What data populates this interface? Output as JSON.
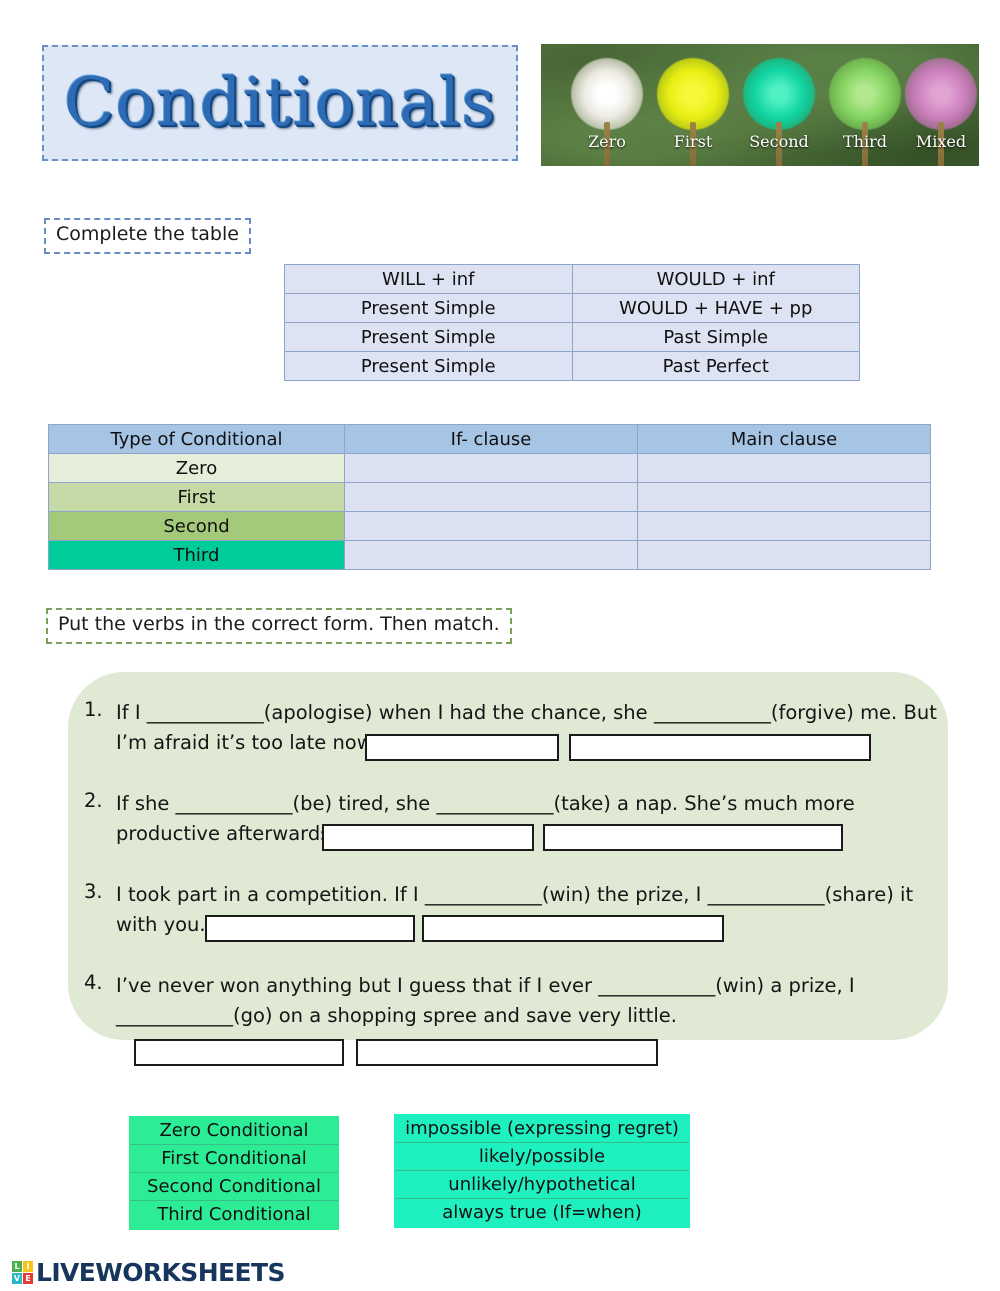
{
  "title": {
    "heading": "Conditionals"
  },
  "banner": {
    "alt": "five colored dandelion puffballs",
    "labels": [
      "Zero",
      "First",
      "Second",
      "Third",
      "Mixed"
    ],
    "colors": [
      "#ece9e0",
      "#e8ee12",
      "#11d5a2",
      "#86d562",
      "#cb7fbd"
    ]
  },
  "instructions": {
    "first": "Complete the table",
    "second": "Put the verbs in the correct form. Then match."
  },
  "forms_table": {
    "rows": [
      [
        "WILL + inf",
        "WOULD + inf"
      ],
      [
        "Present Simple",
        "WOULD + HAVE + pp"
      ],
      [
        "Present Simple",
        "Past Simple"
      ],
      [
        "Present Simple",
        "Past Perfect"
      ]
    ]
  },
  "conditionals_table": {
    "headers": [
      "Type of Conditional",
      "If- clause",
      "Main clause"
    ],
    "rows": [
      {
        "type": "Zero",
        "if_clause": "",
        "main_clause": ""
      },
      {
        "type": "First",
        "if_clause": "",
        "main_clause": ""
      },
      {
        "type": "Second",
        "if_clause": "",
        "main_clause": ""
      },
      {
        "type": "Third",
        "if_clause": "",
        "main_clause": ""
      }
    ]
  },
  "exercise": {
    "items": [
      {
        "number": "1.",
        "line1": "If I ____________(apologise) when I had the chance, she ____________(forgive) me. But",
        "line2": "I’m afraid it’s too late now.",
        "answer1": "",
        "answer2": ""
      },
      {
        "number": "2.",
        "line1": "If she ____________(be) tired, she  ____________(take) a nap. She’s much more",
        "line2": "productive afterwards.",
        "answer1": "",
        "answer2": ""
      },
      {
        "number": "3.",
        "line1": "I took part in a competition. If I ____________(win) the prize, I ____________(share) it",
        "line2": "with you.",
        "answer1": "",
        "answer2": ""
      },
      {
        "number": "4.",
        "line1": "I’ve never won anything but I guess that if I ever ____________(win) a prize, I",
        "line2": "____________(go) on a shopping spree and save very little.",
        "answer1": "",
        "answer2": ""
      }
    ]
  },
  "matching": {
    "left_color": "#2ced95",
    "right_color": "#1ff0c0",
    "left": [
      "Zero Conditional",
      "First Conditional",
      "Second Conditional",
      "Third Conditional"
    ],
    "right": [
      "impossible (expressing regret)",
      "likely/possible",
      "unlikely/hypothetical",
      "always true (If=when)"
    ]
  },
  "footer": {
    "logo_tiles": [
      "L",
      "I",
      "V",
      "E"
    ],
    "logo_text": "LIVEWORKSHEETS"
  }
}
